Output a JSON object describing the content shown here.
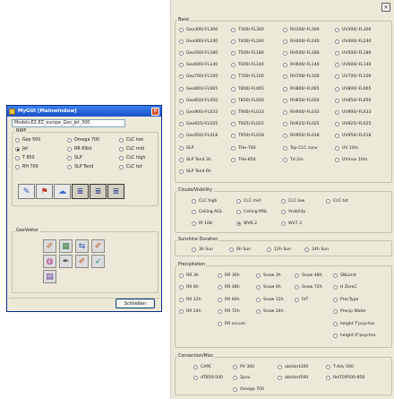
{
  "dialog": {
    "title": "MyGUI [Mainwindow]",
    "model_select": "Models-EZ-EZ_europe_Geo_Jet_300",
    "nwp_title": "NWP",
    "nwp_options": [
      {
        "label": "Geo 500",
        "selected": false
      },
      {
        "label": "Omega 700",
        "selected": false
      },
      {
        "label": "CLC low",
        "selected": false
      },
      {
        "label": "Jet",
        "selected": true
      },
      {
        "label": "RR 6Std",
        "selected": false
      },
      {
        "label": "CLC mid",
        "selected": false
      },
      {
        "label": "T 850",
        "selected": false
      },
      {
        "label": "SLP",
        "selected": false
      },
      {
        "label": "CLC high",
        "selected": false
      },
      {
        "label": "RH 700",
        "selected": false
      },
      {
        "label": "SLP Tend",
        "selected": false
      },
      {
        "label": "CLC tot",
        "selected": false
      }
    ],
    "tool_buttons": [
      "pencil-icon",
      "flag-icon",
      "cloud-icon",
      "layers-icon",
      "layers-icon",
      "layers-icon"
    ],
    "geovektor_title": "GeoVektor",
    "geovektor_buttons": [
      "brush-icon",
      "select-icon",
      "arrows-icon",
      "brush-icon",
      "palette-icon",
      "pen-icon",
      "brush-icon",
      "wind-icon",
      "grid-icon"
    ],
    "close_label": "Schließen"
  },
  "panel": {
    "close_label": "×",
    "basic": {
      "title": "Basic",
      "rows": [
        [
          "Geo300/-FL300",
          "T300/-FL300",
          "RH300/-FL300",
          "UV300/-FL300"
        ],
        [
          "Geo400/-FL240",
          "T400/-FL240",
          "RH400/-FL240",
          "UV400/-FL240"
        ],
        [
          "Geo500/-FL180",
          "T500/-FL180",
          "RH500/-FL180",
          "UV500/-FL180"
        ],
        [
          "Geo600/-FL140",
          "T600/-FL140",
          "RH600/-FL140",
          "UV600/-FL140"
        ],
        [
          "Geo700/-FL100",
          "T700/-FL100",
          "RH700/-FL100",
          "UV700/-FL100"
        ],
        [
          "Geo800/-FL065",
          "T800/-FL065",
          "RH800/-FL065",
          "UV800/-FL065"
        ],
        [
          "Geo850/-FL050",
          "T850/-FL050",
          "RH850/-FL050",
          "UV850/-FL050"
        ],
        [
          "Geo900/-FL033",
          "T900/-FL033",
          "RH900/-FL033",
          "UV900/-FL033"
        ],
        [
          "Geo925/-FL025",
          "T925/-FL025",
          "RH925/-FL025",
          "UV925/-FL025"
        ],
        [
          "Geo950/-FL018",
          "T950/-FL018",
          "RH950/-FL018",
          "UV950/-FL018"
        ],
        [
          "SLP",
          "THe-700",
          "Top CLC conv",
          "UV 10m"
        ],
        [
          "SLP Tend 3h",
          "THe-850",
          "Td 2m",
          "UVmax 10m"
        ],
        [
          "SLP Tend 6h"
        ]
      ]
    },
    "clouds": {
      "title": "Clouds/Visibility",
      "rows": [
        [
          "CLC high",
          "CLC mid",
          "CLC low",
          "CLC tot"
        ],
        [
          "Ceiling AGL",
          "Ceiling MSL",
          "Visibility"
        ],
        [
          "IR 108",
          "WV6.2",
          "WV7.3"
        ]
      ],
      "selected": "WV6.2"
    },
    "sunshine": {
      "title": "Sunshine Duration",
      "options": [
        "3h Sun",
        "6h Sun",
        "12h Sun",
        "24h Sun"
      ]
    },
    "precipitation": {
      "title": "Precipitation",
      "rows": [
        [
          "RR 3h",
          "RR 36h",
          "Snow 3h",
          "Snow 48h",
          "SNLimit"
        ],
        [
          "RR 6h",
          "RR 48h",
          "Snow 6h",
          "Snow 72h",
          "H ZeroC"
        ],
        [
          "RR 12h",
          "RR 60h",
          "Snow 12h",
          "IVT",
          "PrecType"
        ],
        [
          "RR 24h",
          "RR 72h",
          "Snow 24h",
          "",
          "Precip Water"
        ],
        [
          "",
          "RR accum",
          "",
          "",
          "height T'psychro"
        ],
        [
          "",
          "",
          "",
          "",
          "height 0°psychro"
        ]
      ]
    },
    "convection": {
      "title": "Convection/Misc",
      "rows": [
        [
          "CAPE",
          "PV 300",
          "absVort300",
          "T-Adv 500"
        ],
        [
          "dT850-500",
          "2pvu",
          "absVort500",
          "RelTOP500-850"
        ],
        [
          "",
          "Omega 700"
        ]
      ]
    }
  }
}
